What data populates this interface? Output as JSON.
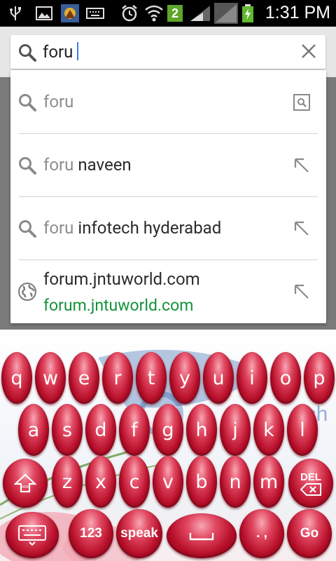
{
  "status_bar": {
    "time": "1:31 PM",
    "notification_count": "2",
    "icons": [
      "usb-icon",
      "gallery-icon",
      "game-app-icon",
      "keyboard-icon",
      "alarm-icon",
      "wifi-icon",
      "data-2-icon",
      "signal-icon",
      "signal-2-icon",
      "battery-charging-icon"
    ]
  },
  "search": {
    "query": "foru",
    "icon": "search-icon",
    "clear_icon": "close-icon"
  },
  "suggestions": [
    {
      "type": "query",
      "prefix": "foru",
      "rest": "",
      "icon": "search-icon",
      "action_icon": "web-search-icon"
    },
    {
      "type": "query",
      "prefix": "foru",
      "rest": " naveen",
      "icon": "search-icon",
      "action_icon": "refine-arrow-icon"
    },
    {
      "type": "query",
      "prefix": "foru",
      "rest": " infotech hyderabad",
      "icon": "search-icon",
      "action_icon": "refine-arrow-icon"
    },
    {
      "type": "url",
      "title": "forum.jntuworld.com",
      "url": "forum.jntuworld.com",
      "icon": "globe-icon",
      "action_icon": "refine-arrow-icon"
    }
  ],
  "keyboard": {
    "row1": [
      "q",
      "w",
      "e",
      "r",
      "t",
      "y",
      "u",
      "i",
      "o",
      "p"
    ],
    "row2": [
      "a",
      "s",
      "d",
      "f",
      "g",
      "h",
      "j",
      "k",
      "l"
    ],
    "row3": [
      "z",
      "x",
      "c",
      "v",
      "b",
      "n",
      "m"
    ],
    "del_label": "DEL",
    "numbers_label": "123",
    "speak_label": "speak",
    "punct_label": ". ,",
    "go_label": "Go",
    "background_text": "ech"
  },
  "colors": {
    "url_green": "#14923a",
    "key_red": "#c2132f",
    "caret_blue": "#3b7be8"
  }
}
